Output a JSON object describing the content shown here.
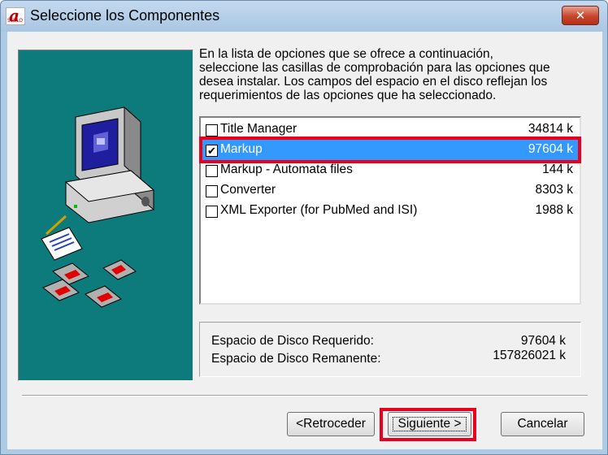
{
  "window": {
    "title": "Seleccione los Componentes",
    "close_symbol": "✕",
    "app_icon_letter": "a",
    "app_icon_text": "SciELO"
  },
  "instructions": {
    "line1": "En la lista de opciones que se ofrece a continuación,",
    "line2": "seleccione las casillas de comprobación para las opciones que",
    "line3": "desea instalar. Los campos del espacio en el disco reflejan los",
    "line4": "requerimientos de las opciones que ha seleccionado."
  },
  "components": [
    {
      "label": "Title Manager",
      "size": "34814 k",
      "checked": false,
      "selected": false
    },
    {
      "label": "Markup",
      "size": "97604 k",
      "checked": true,
      "selected": true
    },
    {
      "label": "Markup - Automata files",
      "size": "144 k",
      "checked": false,
      "selected": false
    },
    {
      "label": "Converter",
      "size": "8303 k",
      "checked": false,
      "selected": false
    },
    {
      "label": "XML Exporter (for PubMed and ISI)",
      "size": "1988 k",
      "checked": false,
      "selected": false
    }
  ],
  "disk": {
    "required_label": "Espacio de Disco Requerido:",
    "required_value": "97604 k",
    "remaining_label": "Espacio de Disco Remanente:",
    "remaining_value": "157826021 k"
  },
  "buttons": {
    "back_label": "<Retroceder",
    "next_label": "Siguiente >",
    "cancel_label": "Cancelar"
  },
  "colors": {
    "side_panel": "#0d7b7b",
    "selection": "#3399ff",
    "highlight": "#e8001c"
  },
  "icons": [
    "computer-monitor-icon",
    "document-pen-icon",
    "floppy-disk-icon"
  ]
}
